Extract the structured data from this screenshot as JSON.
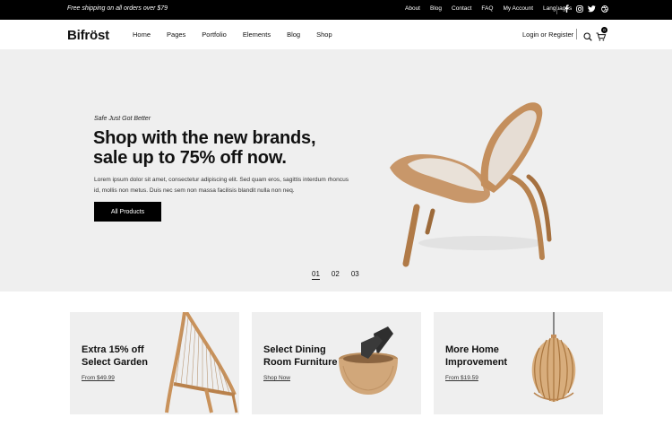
{
  "topbar": {
    "promo": "Free shipping on all orders over $79",
    "links": [
      "About",
      "Blog",
      "Contact",
      "FAQ",
      "My Account",
      "Languages"
    ],
    "social_icons": [
      "facebook-icon",
      "instagram-icon",
      "twitter-icon",
      "dribbble-icon"
    ]
  },
  "header": {
    "logo": "Bifröst",
    "nav": [
      "Home",
      "Pages",
      "Portfolio",
      "Elements",
      "Blog",
      "Shop"
    ],
    "login": "Login or Register",
    "cart_count": "0"
  },
  "hero": {
    "tagline": "Safe Just Got Better",
    "title_line1": "Shop with the new brands,",
    "title_line2": "sale up to 75% off now.",
    "description": "Lorem ipsum dolor sit amet, consectetur adipiscing elit. Sed quam eros, sagittis interdum rhoncus id, mollis non metus. Duis nec sem non massa facilisis blandit nulla non neq.",
    "cta": "All Products",
    "pager": [
      "01",
      "02",
      "03"
    ],
    "active_page": "01"
  },
  "cards": [
    {
      "title_line1": "Extra 15% off",
      "title_line2": "Select Garden",
      "link": "From $49.99"
    },
    {
      "title_line1": "Select Dining",
      "title_line2": "Room Furniture",
      "link": "Shop Now"
    },
    {
      "title_line1": "More Home",
      "title_line2": "Improvement",
      "link": "From $19.59"
    }
  ],
  "colors": {
    "topbar_bg": "#000000",
    "hero_bg": "#efefef",
    "card_bg": "#efefef",
    "button_bg": "#000000",
    "wood": "#c79565"
  }
}
